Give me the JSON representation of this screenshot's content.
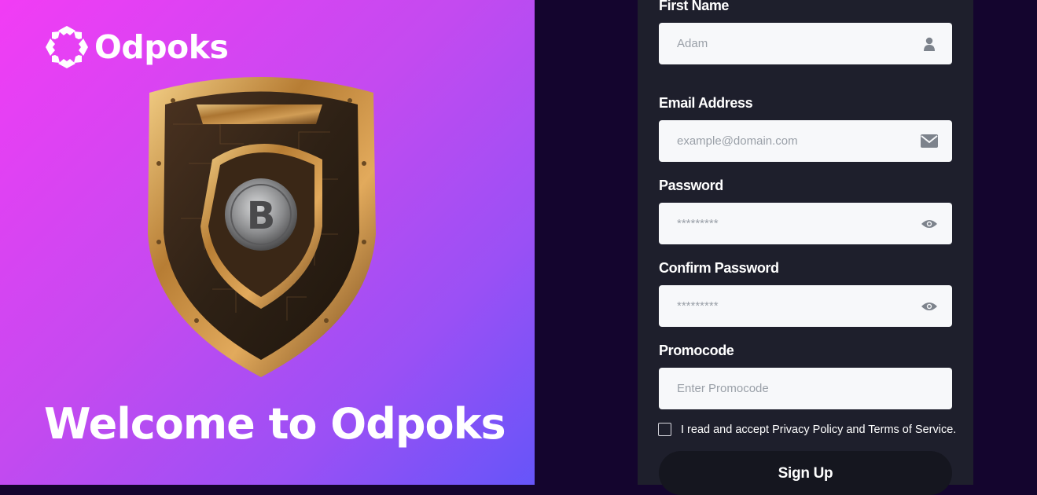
{
  "brand": {
    "name": "Odpoks"
  },
  "hero": {
    "welcome": "Welcome to Odpoks"
  },
  "form": {
    "first_name": {
      "label": "First Name",
      "value": "Adam",
      "icon": "user-icon"
    },
    "email": {
      "label": "Email Address",
      "placeholder": "example@domain.com",
      "icon": "envelope-icon"
    },
    "password": {
      "label": "Password",
      "placeholder": "*********",
      "icon": "eye-icon"
    },
    "confirm_password": {
      "label": "Confirm Password",
      "placeholder": "*********",
      "icon": "eye-icon"
    },
    "promocode": {
      "label": "Promocode",
      "placeholder": "Enter Promocode"
    },
    "terms": {
      "text": "I read and accept Privacy Policy and Terms of Service.",
      "checked": false
    },
    "submit_label": "Sign Up"
  },
  "colors": {
    "gradient_start": "#f23cf5",
    "gradient_end": "#6655f9",
    "page_bg": "#14052e",
    "panel_bg": "#1e1f2c",
    "field_bg": "#f7f8fa",
    "button_bg": "#15161f"
  }
}
